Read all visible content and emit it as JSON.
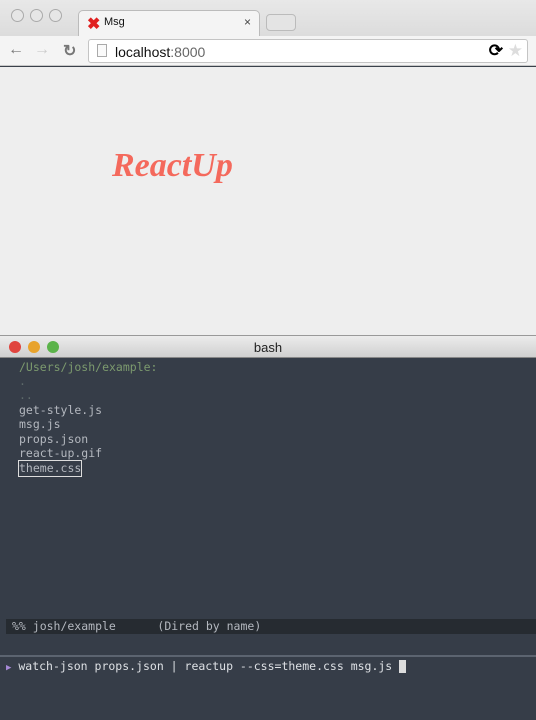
{
  "browser": {
    "tab": {
      "title": "Msg",
      "close": "×"
    },
    "url_host": "localhost",
    "url_port": ":8000"
  },
  "page": {
    "brand": "ReactUp",
    "brand_color": "#f4695c"
  },
  "terminal": {
    "title": "bash",
    "dired": {
      "header": "/Users/josh/example:",
      "entries": [
        ".",
        "..",
        "get-style.js",
        "msg.js",
        "props.json",
        "react-up.gif",
        "theme.css"
      ]
    },
    "modeline": "%% josh/example      (Dired by name)",
    "command": "watch-json props.json | reactup --css=theme.css msg.js"
  }
}
